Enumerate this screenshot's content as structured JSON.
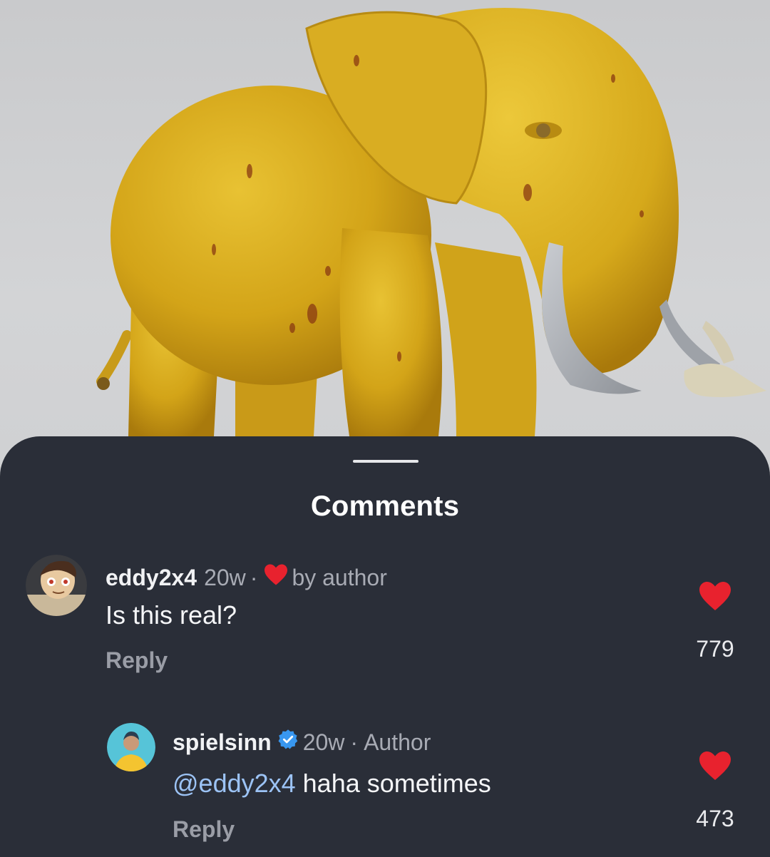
{
  "sheet": {
    "title": "Comments"
  },
  "comments": [
    {
      "username": "eddy2x4",
      "age": "20w",
      "separator": "·",
      "badge_text": "by author",
      "text": "Is this real?",
      "reply_label": "Reply",
      "like_count": "779"
    }
  ],
  "replies": [
    {
      "username": "spielsinn",
      "age": "20w",
      "separator": "·",
      "role": "Author",
      "mention": "@eddy2x4",
      "text": " haha sometimes",
      "reply_label": "Reply",
      "like_count": "473"
    }
  ],
  "colors": {
    "sheet_background": "#2a2e38",
    "like_red": "#e8222e",
    "verified_blue": "#3897f0",
    "mention_blue": "#9cc3f5"
  },
  "icons": [
    "heart-icon",
    "verified-badge-icon"
  ]
}
